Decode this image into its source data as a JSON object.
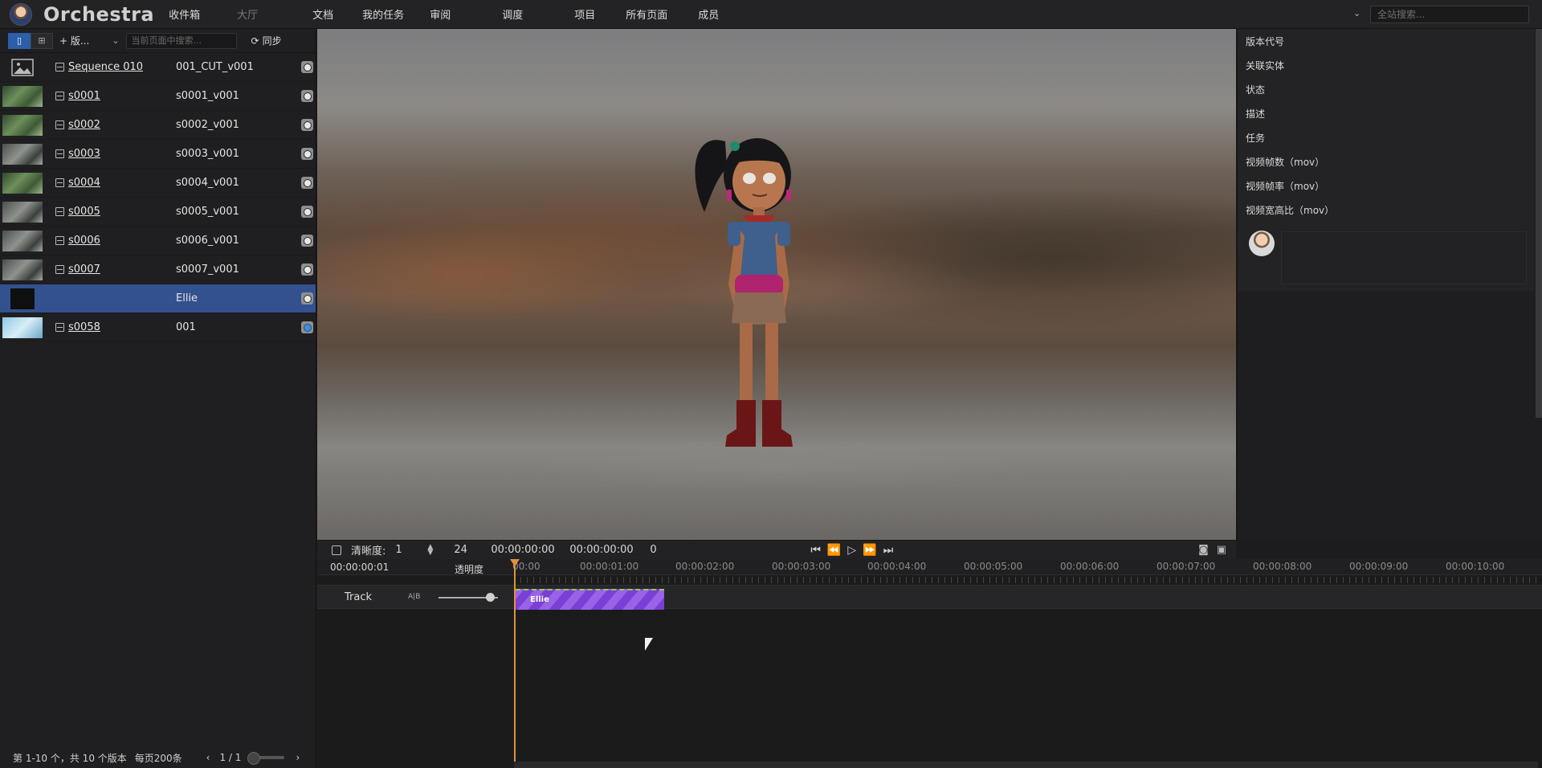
{
  "header": {
    "brand": "Orchestra",
    "nav": [
      {
        "label": "收件箱",
        "dim": false
      },
      {
        "label": "大厅",
        "dim": true
      },
      {
        "label": "文档",
        "dim": false
      },
      {
        "label": "我的任务",
        "dim": false
      },
      {
        "label": "审阅",
        "dim": false
      },
      {
        "label": "调度",
        "dim": false
      },
      {
        "label": "项目",
        "dim": false
      },
      {
        "label": "所有页面",
        "dim": false
      },
      {
        "label": "成员",
        "dim": false
      }
    ],
    "search_placeholder": "全站搜索..."
  },
  "left_panel": {
    "add_label": "+ 版...",
    "search_placeholder": "当前页面中搜索...",
    "sync_label": "同步",
    "rows": [
      {
        "entity": "Sequence 010",
        "version": "001_CUT_v001",
        "thumb": "placeholder",
        "selected": false
      },
      {
        "entity": "s0001",
        "version": "s0001_v001",
        "thumb": "green",
        "selected": false
      },
      {
        "entity": "s0002",
        "version": "s0002_v001",
        "thumb": "green",
        "selected": false
      },
      {
        "entity": "s0003",
        "version": "s0003_v001",
        "thumb": "grey",
        "selected": false
      },
      {
        "entity": "s0004",
        "version": "s0004_v001",
        "thumb": "green",
        "selected": false
      },
      {
        "entity": "s0005",
        "version": "s0005_v001",
        "thumb": "grey",
        "selected": false
      },
      {
        "entity": "s0006",
        "version": "s0006_v001",
        "thumb": "grey",
        "selected": false
      },
      {
        "entity": "s0007",
        "version": "s0007_v001",
        "thumb": "grey",
        "selected": false
      },
      {
        "entity": "",
        "version": "Ellie",
        "thumb": "dark",
        "selected": true
      },
      {
        "entity": "s0058",
        "version": "001",
        "thumb": "sky",
        "selected": false,
        "status": "blue"
      }
    ],
    "footer": {
      "summary": "第 1-10 个，共 10 个版本",
      "per_page": "每页200条",
      "page": "1 / 1"
    }
  },
  "player": {
    "quality_label": "清晰度:",
    "quality_value": "1",
    "fps": "24",
    "timecode_current": "00:00:00:00",
    "timecode_duration": "00:00:00:00",
    "frame": "0"
  },
  "timeline": {
    "timecode": "00:00:00:01",
    "opacity_label": "透明度",
    "ruler": [
      "00:00",
      "00:00:01:00",
      "00:00:02:00",
      "00:00:03:00",
      "00:00:04:00",
      "00:00:05:00",
      "00:00:06:00",
      "00:00:07:00",
      "00:00:08:00",
      "00:00:09:00",
      "00:00:10:00"
    ],
    "track_name": "Track",
    "clip_label": "Ellie",
    "opacity_value": 0.87
  },
  "details": {
    "fields": [
      "版本代号",
      "关联实体",
      "状态",
      "描述",
      "任务",
      "视频帧数（mov）",
      "视频帧率（mov）",
      "视频宽高比（mov）"
    ]
  },
  "colors": {
    "selected_row": "#33518f",
    "clip": "#7a3fd4",
    "playhead": "#e3913a",
    "accent": "#2d5ea8"
  }
}
